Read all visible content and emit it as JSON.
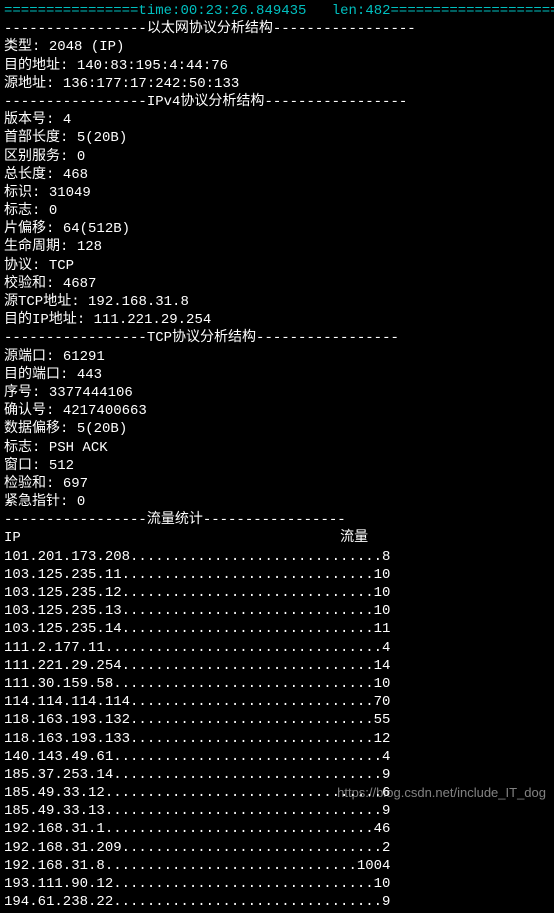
{
  "header": {
    "time_label": "time",
    "time_value": "00:23:26.849435",
    "len_label": "len",
    "len_value": "482"
  },
  "sections": {
    "ethernet_title": "以太网协议分析结构",
    "ipv4_title": "IPv4协议分析结构",
    "tcp_title": "TCP协议分析结构",
    "stats_title": "流量统计"
  },
  "ethernet": {
    "type_label": "类型",
    "type_value": "2048 (IP)",
    "dst_label": "目的地址",
    "dst_value": "140:83:195:4:44:76",
    "src_label": "源地址",
    "src_value": "136:177:17:242:50:133"
  },
  "ipv4": {
    "version_label": "版本号",
    "version_value": "4",
    "header_len_label": "首部长度",
    "header_len_value": "5(20B)",
    "diffserv_label": "区别服务",
    "diffserv_value": "0",
    "total_len_label": "总长度",
    "total_len_value": "468",
    "id_label": "标识",
    "id_value": "31049",
    "flags_label": "标志",
    "flags_value": "0",
    "frag_label": "片偏移",
    "frag_value": "64(512B)",
    "ttl_label": "生命周期",
    "ttl_value": "128",
    "proto_label": "协议",
    "proto_value": "TCP",
    "checksum_label": "校验和",
    "checksum_value": "4687",
    "src_ip_label": "源TCP地址",
    "src_ip_value": "192.168.31.8",
    "dst_ip_label": "目的IP地址",
    "dst_ip_value": "111.221.29.254"
  },
  "tcp": {
    "src_port_label": "源端口",
    "src_port_value": "61291",
    "dst_port_label": "目的端口",
    "dst_port_value": "443",
    "seq_label": "序号",
    "seq_value": "3377444106",
    "ack_label": "确认号",
    "ack_value": "4217400663",
    "offset_label": "数据偏移",
    "offset_value": "5(20B)",
    "flags_label": "标志",
    "flags_value": "PSH ACK",
    "window_label": "窗口",
    "window_value": "512",
    "checksum_label": "检验和",
    "checksum_value": "697",
    "urgent_label": "紧急指针",
    "urgent_value": "0"
  },
  "stats": {
    "col_ip": "IP",
    "col_traffic": "流量",
    "rows": [
      {
        "ip": "101.201.173.208",
        "value": "8"
      },
      {
        "ip": "103.125.235.11",
        "value": "10"
      },
      {
        "ip": "103.125.235.12",
        "value": "10"
      },
      {
        "ip": "103.125.235.13",
        "value": "10"
      },
      {
        "ip": "103.125.235.14",
        "value": "11"
      },
      {
        "ip": "111.2.177.11",
        "value": "4"
      },
      {
        "ip": "111.221.29.254",
        "value": "14"
      },
      {
        "ip": "111.30.159.58",
        "value": "10"
      },
      {
        "ip": "114.114.114.114",
        "value": "70"
      },
      {
        "ip": "118.163.193.132",
        "value": "55"
      },
      {
        "ip": "118.163.193.133",
        "value": "12"
      },
      {
        "ip": "140.143.49.61",
        "value": "4"
      },
      {
        "ip": "185.37.253.14",
        "value": "9"
      },
      {
        "ip": "185.49.33.12",
        "value": "6"
      },
      {
        "ip": "185.49.33.13",
        "value": "9"
      },
      {
        "ip": "192.168.31.1",
        "value": "46"
      },
      {
        "ip": "192.168.31.209",
        "value": "2"
      },
      {
        "ip": "192.168.31.8",
        "value": "1004"
      },
      {
        "ip": "193.111.90.12",
        "value": "10"
      },
      {
        "ip": "194.61.238.22",
        "value": "9"
      }
    ]
  },
  "watermark": "https://blog.csdn.net/include_IT_dog"
}
